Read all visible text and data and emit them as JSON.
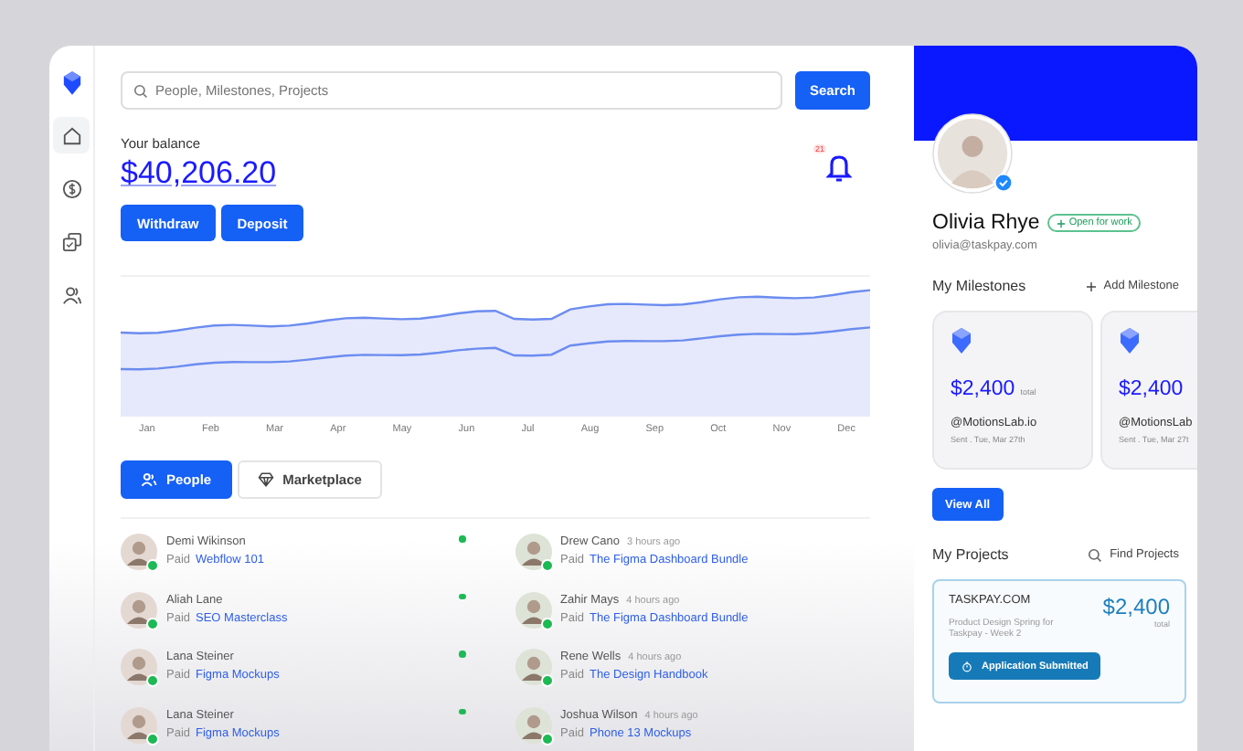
{
  "sidebar": {
    "items": [
      {
        "kind": "home",
        "selected": true
      },
      {
        "kind": "dollar",
        "selected": false
      },
      {
        "kind": "copy",
        "selected": false
      },
      {
        "kind": "users",
        "selected": false
      }
    ]
  },
  "search": {
    "placeholder": "People, Milestones, Projects",
    "button": "Search"
  },
  "balance": {
    "label": "Your balance",
    "amount": "$40,206.20",
    "actions": [
      "Withdraw",
      "Deposit"
    ],
    "notifications": "21"
  },
  "chart_months": [
    "Jan",
    "Feb",
    "Mar",
    "Apr",
    "May",
    "Jun",
    "Jul",
    "Aug",
    "Sep",
    "Oct",
    "Nov",
    "Dec"
  ],
  "tabs": [
    {
      "label": "People",
      "kind": "people",
      "selected": true
    },
    {
      "label": "Marketplace",
      "kind": "market",
      "selected": false
    }
  ],
  "activity": [
    {
      "left": {
        "name": "Demi Wikinson",
        "paid": "Paid",
        "item": "Webflow 101",
        "online": true
      },
      "right": {
        "name": "Drew Cano",
        "time": "3 hours ago",
        "paid": "Paid",
        "item": "The Figma Dashboard Bundle",
        "online": true
      }
    },
    {
      "left": {
        "name": "Aliah Lane",
        "paid": "Paid",
        "item": "SEO Masterclass",
        "online": true
      },
      "right": {
        "name": "Zahir Mays",
        "time": "4 hours ago",
        "paid": "Paid",
        "item": "The Figma Dashboard Bundle",
        "online": true
      }
    },
    {
      "left": {
        "name": "Lana Steiner",
        "paid": "Paid",
        "item": "Figma Mockups",
        "online": true
      },
      "right": {
        "name": "Rene Wells",
        "time": "4 hours ago",
        "paid": "Paid",
        "item": "The Design Handbook",
        "online": true
      }
    },
    {
      "left": {
        "name": "Lana Steiner",
        "paid": "Paid",
        "item": "Figma Mockups",
        "online": true
      },
      "right": {
        "name": "Joshua Wilson",
        "time": "4 hours ago",
        "paid": "Paid",
        "item": "Phone 13 Mockups",
        "online": true
      }
    }
  ],
  "profile": {
    "name": "Olivia Rhye",
    "status": "Open for work",
    "email": "olivia@taskpay.com",
    "verified": true
  },
  "milestones": {
    "title": "My Milestones",
    "add": "Add Milestone",
    "view_all": "View All",
    "cards": [
      {
        "amount": "$2,400",
        "unit": "total",
        "handle": "@MotionsLab.io",
        "sent": "Sent . Tue, Mar 27th"
      },
      {
        "amount": "$2,400",
        "handle": "@MotionsLab",
        "sent": "Sent . Tue, Mar 27t"
      }
    ]
  },
  "projects": {
    "title": "My Projects",
    "find": "Find Projects",
    "card": {
      "company": "TASKPAY.COM",
      "description": "Product Design Spring for Taskpay - Week 2",
      "amount": "$2,400",
      "unit": "total",
      "status": "Application Submitted"
    }
  }
}
